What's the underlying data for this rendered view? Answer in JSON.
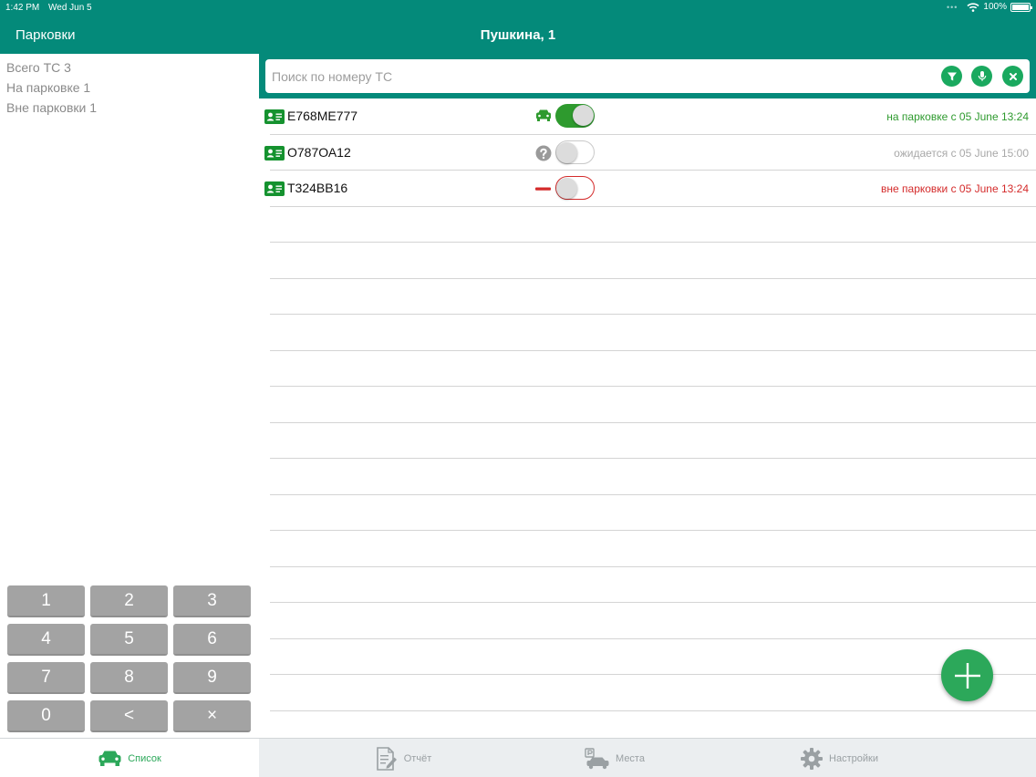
{
  "status_bar": {
    "time": "1:42 PM",
    "date": "Wed Jun 5",
    "battery": "100%"
  },
  "nav": {
    "back_label": "Парковки",
    "title": "Пушкина, 1"
  },
  "stats": {
    "total": "Всего ТС 3",
    "parked": "На парковке 1",
    "away": "Вне парковки 1"
  },
  "keypad": [
    "1",
    "2",
    "3",
    "4",
    "5",
    "6",
    "7",
    "8",
    "9",
    "0",
    "<",
    "×"
  ],
  "search": {
    "placeholder": "Поиск по номеру ТС",
    "value": ""
  },
  "vehicles": [
    {
      "plate": "Е768МЕ777",
      "state": "parked",
      "state_icon": "car-icon",
      "toggle_on": true,
      "status": "на парковке с 05 June 13:24",
      "color": "#2e9a2e"
    },
    {
      "plate": "О787ОА12",
      "state": "expected",
      "state_icon": "question-icon",
      "toggle_on": false,
      "status": "ожидается с 05 June 15:00",
      "color": "#a8a8a8"
    },
    {
      "plate": "Т324ВВ16",
      "state": "away",
      "state_icon": "minus-icon",
      "toggle_on": false,
      "status": "вне парковки с 05 June 13:24",
      "color": "#d42b2b"
    }
  ],
  "colors": {
    "header": "#048a7a",
    "accent": "#2ca85a",
    "parked": "#2e9a2e",
    "away": "#d42b2b",
    "expected": "#a8a8a8"
  },
  "tabs": [
    {
      "label": "Список",
      "icon": "car-icon",
      "active": true
    },
    {
      "label": "Отчёт",
      "icon": "report-icon",
      "active": false
    },
    {
      "label": "Места",
      "icon": "parking-places-icon",
      "active": false
    },
    {
      "label": "Настройки",
      "icon": "gear-icon",
      "active": false
    }
  ]
}
